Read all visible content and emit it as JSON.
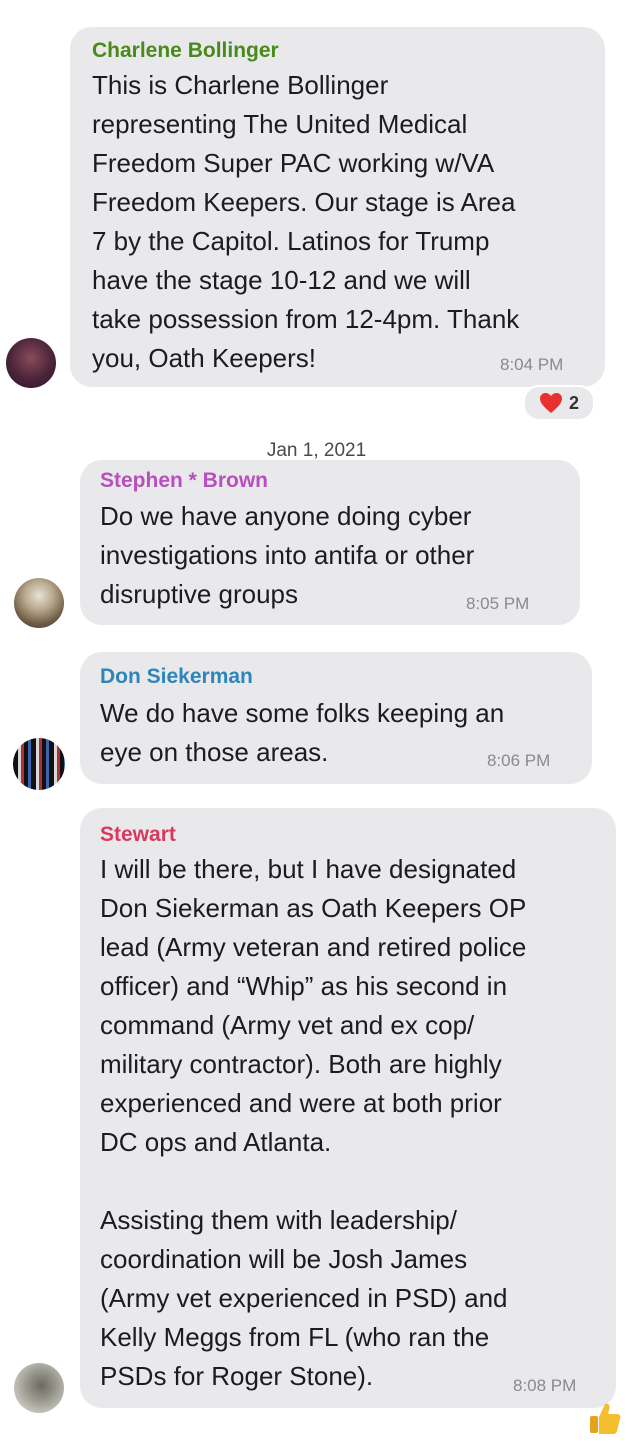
{
  "messages": [
    {
      "sender": "Charlene Bollinger",
      "sender_color": "#4a8a1c",
      "lines": [
        "This is Charlene Bollinger",
        "representing The United Medical",
        "Freedom Super PAC working w/VA",
        "Freedom Keepers. Our stage is Area",
        "7 by the Capitol. Latinos for Trump",
        "have the stage 10-12 and we will",
        "take possession from 12-4pm. Thank",
        "you, Oath Keepers!"
      ],
      "time": "8:04 PM",
      "reaction": {
        "icon": "heart-icon",
        "count": "2"
      }
    },
    {
      "sender": "Stephen * Brown",
      "sender_color": "#b84fbf",
      "lines": [
        "Do we have anyone doing cyber",
        "investigations into antifa or other",
        "disruptive groups"
      ],
      "time": "8:05 PM"
    },
    {
      "sender": "Don Siekerman",
      "sender_color": "#2e86b8",
      "lines": [
        "We do have some folks keeping an",
        "eye on those areas."
      ],
      "time": "8:06 PM"
    },
    {
      "sender": "Stewart",
      "sender_color": "#d8395e",
      "lines": [
        "I will be there, but I have designated",
        "Don Siekerman as Oath Keepers OP",
        "lead (Army veteran and retired police",
        "officer) and “Whip” as his second in",
        "command (Army vet and ex cop/",
        "military contractor). Both are highly",
        "experienced and were at both prior",
        "DC ops and Atlanta.",
        "",
        "Assisting them with leadership/",
        "coordination will be Josh James",
        "(Army vet experienced in PSD) and",
        "Kelly Meggs from FL (who ran the",
        "PSDs for Roger Stone)."
      ],
      "time": "8:08 PM",
      "reaction": {
        "icon": "thumbs-up-icon"
      }
    }
  ],
  "date_separator": "Jan 1, 2021"
}
